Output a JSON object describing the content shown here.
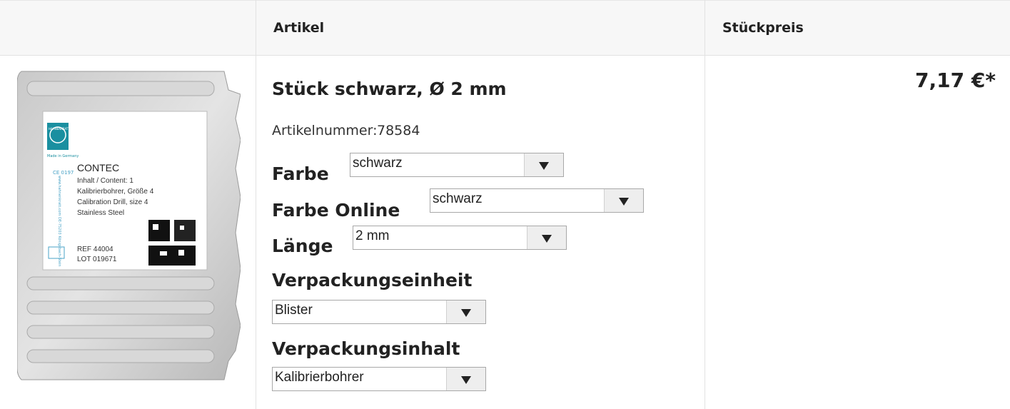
{
  "header": {
    "article_col": "Artikel",
    "price_col": "Stückpreis"
  },
  "product": {
    "title": "Stück schwarz, Ø 2 mm",
    "article_number_label": "Artikelnummer:",
    "article_number": "78584",
    "price": "7,17 €*",
    "image": {
      "brand": "HAHNENKRATT",
      "made_in": "Made in Germany",
      "product_name": "CONTEC",
      "line1": "Inhalt / Content: 1",
      "line2": "Kalibrierbohrer, Größe 4",
      "line3": "Calibration Drill, size 4",
      "line4": "Stainless Steel",
      "ref": "REF 44004",
      "lot": "LOT 019671",
      "ce": "CE 0197",
      "side_text": "www.hahnenkratt.com DE-75203 Königsbach-Stein"
    }
  },
  "options": {
    "farbe": {
      "label": "Farbe",
      "value": "schwarz"
    },
    "farbe_online": {
      "label": "Farbe Online",
      "value": "schwarz"
    },
    "laenge": {
      "label": "Länge",
      "value": "2 mm"
    },
    "verpackungseinheit": {
      "label": "Verpackungseinheit",
      "value": "Blister"
    },
    "verpackungsinhalt": {
      "label": "Verpackungsinhalt",
      "value": "Kalibrierbohrer"
    }
  },
  "colors": {
    "header_bg": "#f7f7f7",
    "border": "#e2e2e2",
    "text": "#222222",
    "logo_teal": "#1a8fa0"
  }
}
